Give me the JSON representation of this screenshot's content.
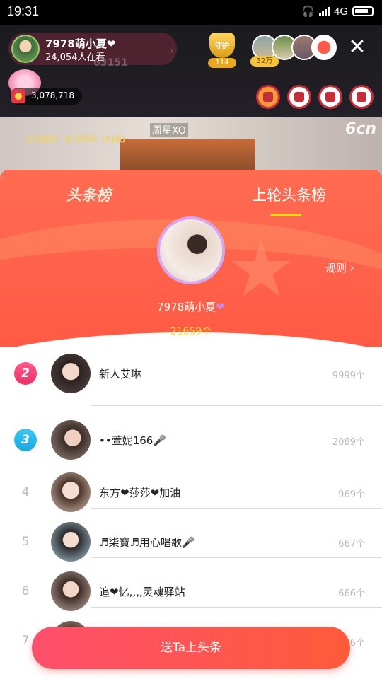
{
  "status_bar": {
    "time": "19:31",
    "network": "4G"
  },
  "live_header": {
    "host_name": "7978萌小夏❤",
    "viewers": "24,054人在看",
    "faded_id": "63151",
    "guard_label": "守护",
    "guard_count": "114",
    "audience_badge": "32万",
    "coin_balance": "3,078,718"
  },
  "video": {
    "now_playing": "正在播放：金-我很忙 (DJ版)",
    "streamer_tag": "周星XO",
    "watermark": "6cn"
  },
  "board": {
    "tab_current": "头条榜",
    "tab_previous": "上轮头条榜",
    "rules_label": "规则",
    "top_user": {
      "name": "7978萌小夏",
      "count": "21659个"
    },
    "entries": [
      {
        "rank": "2",
        "name": "新人艾琳",
        "count": "9999个"
      },
      {
        "rank": "3",
        "name": "••萱妮166🎤",
        "count": "2089个"
      },
      {
        "rank": "4",
        "name": "东方❤莎莎❤加油",
        "count": "969个"
      },
      {
        "rank": "5",
        "name": "♬柒寶♬用心唱歌🎤",
        "count": "667个"
      },
      {
        "rank": "6",
        "name": "追❤忆,,,,灵魂驿站",
        "count": "666个"
      },
      {
        "rank": "7",
        "name": "",
        "count": "666个"
      }
    ],
    "cta_label": "送Ta上头条"
  },
  "colors": {
    "accent": "#ff5a44",
    "rank2": "#e8336a",
    "rank3": "#18a8e0",
    "highlight": "#ffd21e"
  }
}
